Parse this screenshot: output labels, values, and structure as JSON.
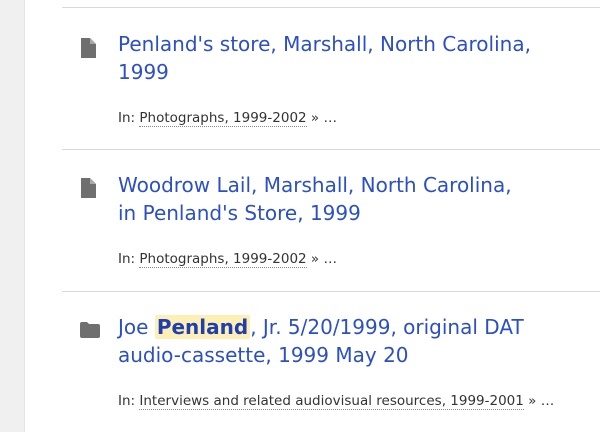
{
  "results": [
    {
      "icon": "file-icon",
      "title_line1": "Penland's store, Marshall, North Carolina,",
      "title_line2": "1999",
      "context_prefix": "In:",
      "context_link": "Photographs, 1999-2002",
      "context_suffix": "» …"
    },
    {
      "icon": "file-icon",
      "title_line1": "Woodrow Lail, Marshall, North Carolina,",
      "title_line2": "in Penland's Store, 1999",
      "context_prefix": "In:",
      "context_link": "Photographs, 1999-2002",
      "context_suffix": "» …"
    },
    {
      "icon": "folder-icon",
      "title_before": "Joe",
      "title_highlight": "Penland",
      "title_after": ", Jr. 5/20/1999, original DAT",
      "title_line2": "audio-cassette, 1999 May 20",
      "context_prefix": "In:",
      "context_link": "Interviews and related audiovisual resources, 1999-2001",
      "context_suffix": "» …"
    }
  ],
  "colors": {
    "link": "#2b4fc8",
    "highlight_bg": "#fdefb5",
    "icon": "#6f6f6f",
    "divider": "#d9d9d9"
  }
}
